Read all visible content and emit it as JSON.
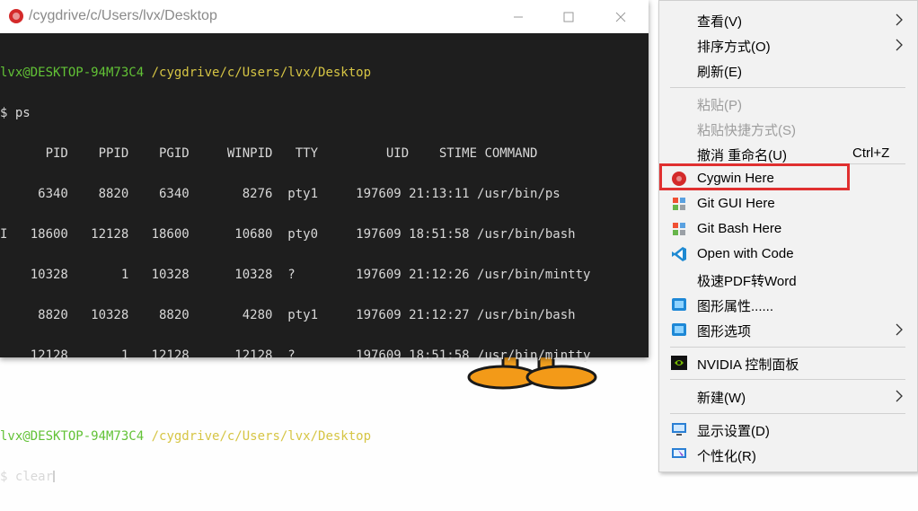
{
  "terminal": {
    "title": "/cygdrive/c/Users/lvx/Desktop",
    "prompt1_user": "lvx@DESKTOP-94M73C4",
    "prompt1_path": "/cygdrive/c/Users/lvx/Desktop",
    "cmd1": "$ ps",
    "ps_lines": [
      "      PID    PPID    PGID     WINPID   TTY         UID    STIME COMMAND",
      "     6340    8820    6340       8276  pty1     197609 21:13:11 /usr/bin/ps",
      "I   18600   12128   18600      10680  pty0     197609 18:51:58 /usr/bin/bash",
      "    10328       1   10328      10328  ?        197609 21:12:26 /usr/bin/mintty",
      "     8820   10328    8820       4280  pty1     197609 21:12:27 /usr/bin/bash",
      "    12128       1   12128      12128  ?        197609 18:51:58 /usr/bin/mintty"
    ],
    "prompt2_user": "lvx@DESKTOP-94M73C4",
    "prompt2_path": "/cygdrive/c/Users/lvx/Desktop",
    "cmd2": "$ clear"
  },
  "menu": {
    "items": [
      {
        "label": "查看(V)",
        "submenu": true
      },
      {
        "label": "排序方式(O)",
        "submenu": true
      },
      {
        "label": "刷新(E)"
      },
      {
        "label": "粘贴(P)",
        "disabled": true
      },
      {
        "label": "粘贴快捷方式(S)",
        "disabled": true
      },
      {
        "label": "撤消 重命名(U)",
        "shortcut": "Ctrl+Z"
      },
      {
        "label": "Cygwin Here",
        "icon": "cygwin-icon"
      },
      {
        "label": "Git GUI Here",
        "icon": "git-icon"
      },
      {
        "label": "Git Bash Here",
        "icon": "git-icon"
      },
      {
        "label": "Open with Code",
        "icon": "vscode-icon"
      },
      {
        "label": "极速PDF转Word"
      },
      {
        "label": "图形属性......",
        "icon": "intel-graphics-icon"
      },
      {
        "label": "图形选项",
        "icon": "intel-graphics-icon",
        "submenu": true
      },
      {
        "label": "NVIDIA 控制面板",
        "icon": "nvidia-icon"
      },
      {
        "label": "新建(W)",
        "submenu": true
      },
      {
        "label": "显示设置(D)",
        "icon": "display-settings-icon"
      },
      {
        "label": "个性化(R)",
        "icon": "personalize-icon"
      }
    ]
  },
  "colors": {
    "highlight": "#e03030",
    "prompt_user": "#62c236",
    "prompt_path": "#d6c544"
  }
}
